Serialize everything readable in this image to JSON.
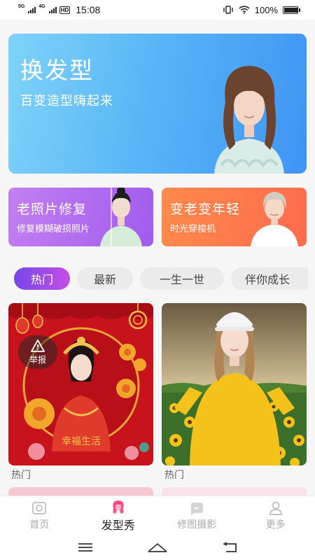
{
  "status_bar": {
    "sim1": "5G",
    "sim2": "4G",
    "hd": "HD",
    "time": "15:08",
    "battery": "100%",
    "battery_level": 1.0
  },
  "hero": {
    "title": "换发型",
    "subtitle": "百变造型嗨起来"
  },
  "features": [
    {
      "title": "老照片修复",
      "subtitle": "修复模糊破损照片"
    },
    {
      "title": "变老变年轻",
      "subtitle": "时光穿梭机"
    }
  ],
  "categories": [
    {
      "label": "热门",
      "active": true
    },
    {
      "label": "最新",
      "active": false
    },
    {
      "label": "一生一世",
      "active": false
    },
    {
      "label": "伴你成长",
      "active": false
    }
  ],
  "cards": [
    {
      "label": "热门",
      "report_label": "举报",
      "caption": "幸福生活"
    },
    {
      "label": "热门"
    }
  ],
  "bottom_nav": [
    {
      "label": "首页",
      "icon": "home-icon",
      "active": false
    },
    {
      "label": "发型秀",
      "icon": "hairstyle-icon",
      "active": true
    },
    {
      "label": "修图摄影",
      "icon": "photo-edit-icon",
      "active": false
    },
    {
      "label": "更多",
      "icon": "user-icon",
      "active": false
    }
  ],
  "colors": {
    "accent": "#7646e8",
    "accent_end": "#c34fe6",
    "hero": "#4fa7f5",
    "old_photo_card": "#b06cef",
    "age_card": "#ff744c",
    "nav_active": "#ff4f86"
  }
}
